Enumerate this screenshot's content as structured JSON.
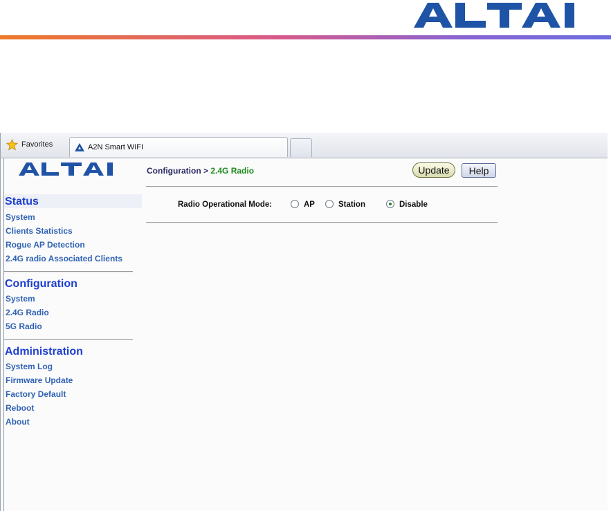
{
  "doc_header": {
    "logo_text": "ALTAI",
    "rule_colors": [
      "#ee7a27",
      "#d85a8a",
      "#8a63d2",
      "#6d6de0"
    ]
  },
  "browser": {
    "favorites_label": "Favorites",
    "favorites_icon": "star-icon",
    "tab_title": "A2N Smart WIFI",
    "tab_icon": "altai-favicon"
  },
  "sidebar": {
    "logo_text": "ALTAI",
    "sections": [
      {
        "title": "Status",
        "items": [
          "System",
          "Clients Statistics",
          "Rogue AP Detection",
          "2.4G radio Associated Clients"
        ]
      },
      {
        "title": "Configuration",
        "items": [
          "System",
          "2.4G Radio",
          "5G Radio"
        ]
      },
      {
        "title": "Administration",
        "items": [
          "System Log",
          "Firmware Update",
          "Factory Default",
          "Reboot",
          "About"
        ]
      }
    ],
    "colors": {
      "section": "#1f3fd0",
      "link": "#3163b4"
    }
  },
  "main": {
    "breadcrumb_parent": "Configuration",
    "breadcrumb_sep": ">",
    "breadcrumb_current": "2.4G Radio",
    "update_label": "Update",
    "help_label": "Help",
    "mode_label": "Radio Operational Mode:",
    "options": [
      {
        "label": "AP",
        "selected": false
      },
      {
        "label": "Station",
        "selected": false
      },
      {
        "label": "Disable",
        "selected": true
      }
    ]
  }
}
